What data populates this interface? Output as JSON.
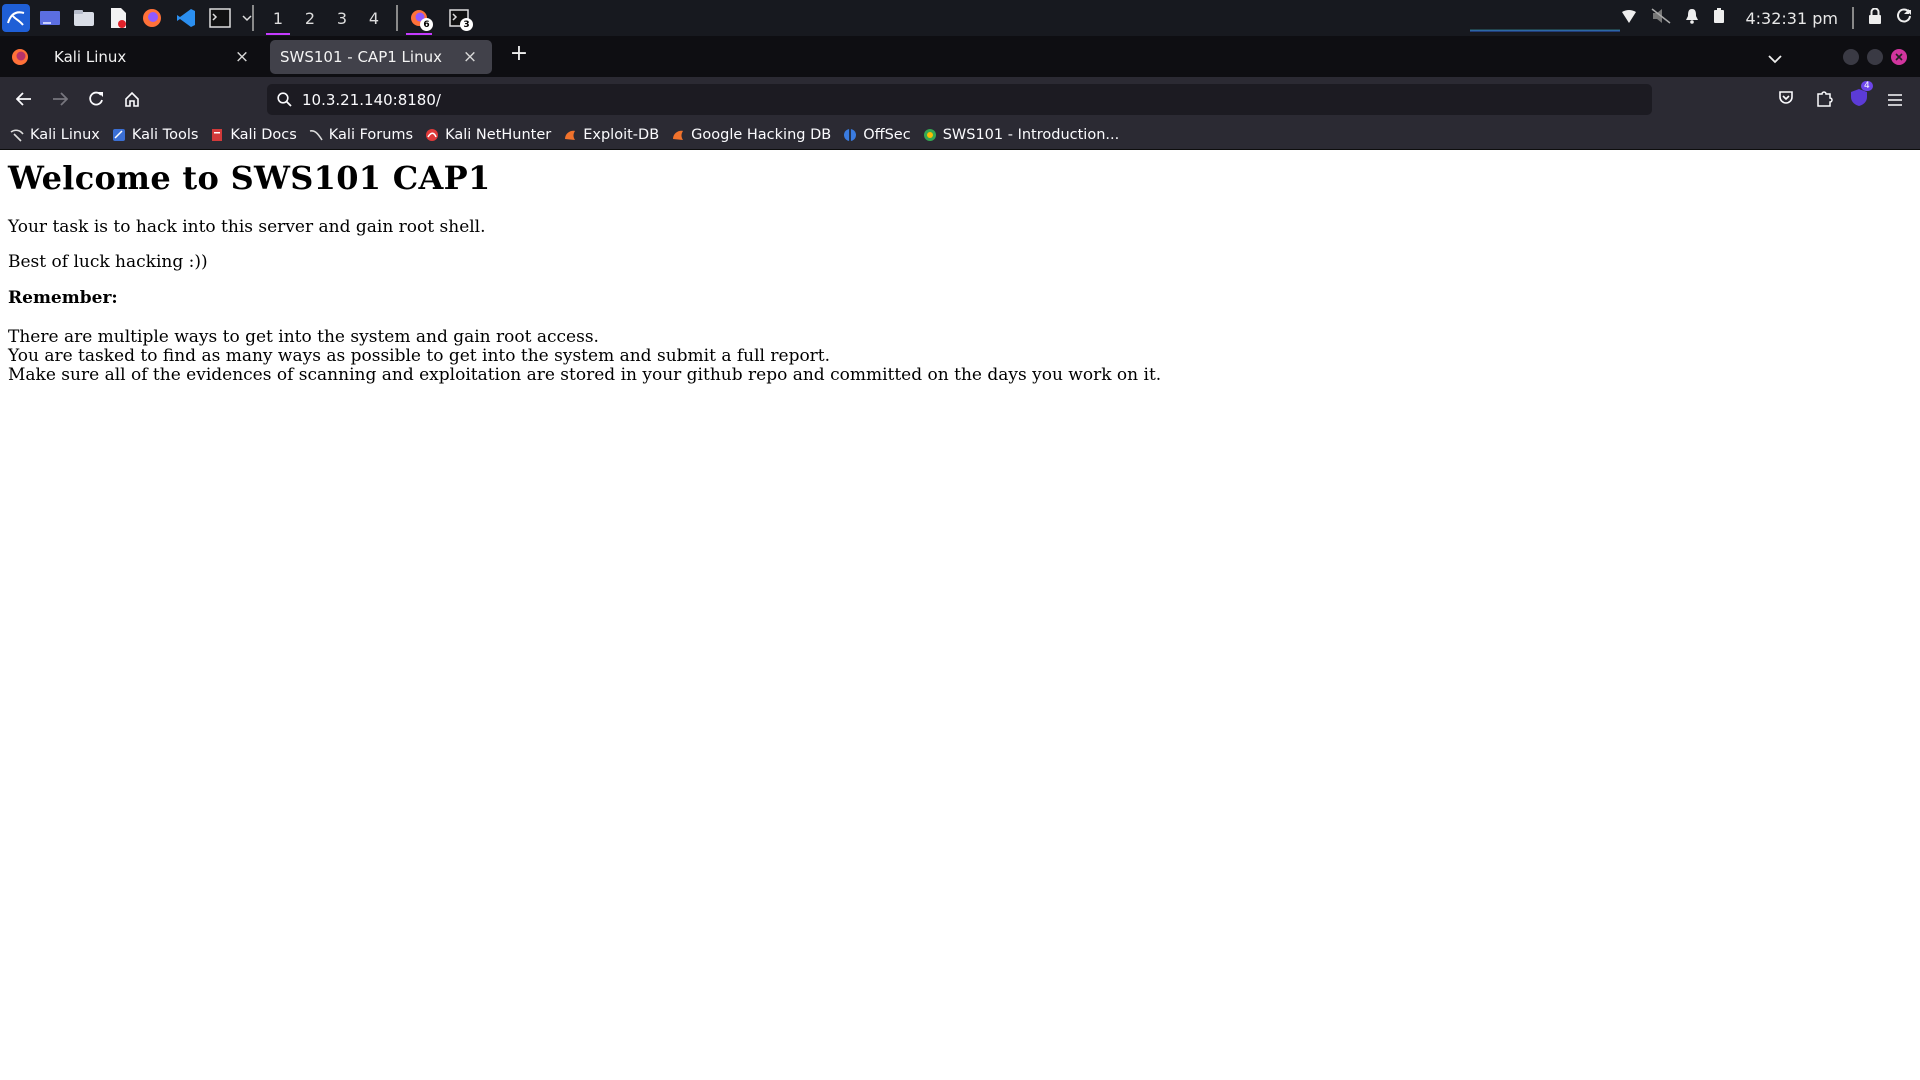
{
  "panel": {
    "workspaces": [
      "1",
      "2",
      "3",
      "4"
    ],
    "active_workspace": "1",
    "tasks": [
      {
        "icon": "firefox-icon",
        "count": "6"
      },
      {
        "icon": "terminal-icon",
        "count": "3"
      }
    ],
    "clock": "4:32:31 pm"
  },
  "browser": {
    "tabs": [
      {
        "title": "Kali Linux",
        "close": "×"
      },
      {
        "title": "SWS101 - CAP1 Linux",
        "close": "×"
      }
    ],
    "new_tab": "+",
    "url": "10.3.21.140:8180/",
    "extension_badge": "4",
    "bookmarks": [
      {
        "label": "Kali Linux",
        "icon": "kali-dragon-icon"
      },
      {
        "label": "Kali Tools",
        "icon": "kali-tools-icon"
      },
      {
        "label": "Kali Docs",
        "icon": "kali-docs-icon"
      },
      {
        "label": "Kali Forums",
        "icon": "kali-forums-icon"
      },
      {
        "label": "Kali NetHunter",
        "icon": "nethunter-icon"
      },
      {
        "label": "Exploit-DB",
        "icon": "exploit-db-icon"
      },
      {
        "label": "Google Hacking DB",
        "icon": "ghdb-icon"
      },
      {
        "label": "OffSec",
        "icon": "offsec-icon"
      },
      {
        "label": "SWS101 - Introduction...",
        "icon": "sws101-icon"
      }
    ]
  },
  "page": {
    "heading": "Welcome to SWS101 CAP1",
    "p1": "Your task is to hack into this server and gain root shell.",
    "p2": "Best of luck hacking :))",
    "p3": "Remember:",
    "lines": [
      "There are multiple ways to get into the system and gain root access.",
      "You are tasked to find as many ways as possible to get into the system and submit a full report.",
      "Make sure all of the evidences of scanning and exploitation are stored in your github repo and committed on the days you work on it."
    ]
  },
  "colors": {
    "panel_bg": "#17191f",
    "tabbar_bg": "#0e0e12",
    "toolbar_bg": "#2b2a33",
    "accent": "#c53bff"
  }
}
